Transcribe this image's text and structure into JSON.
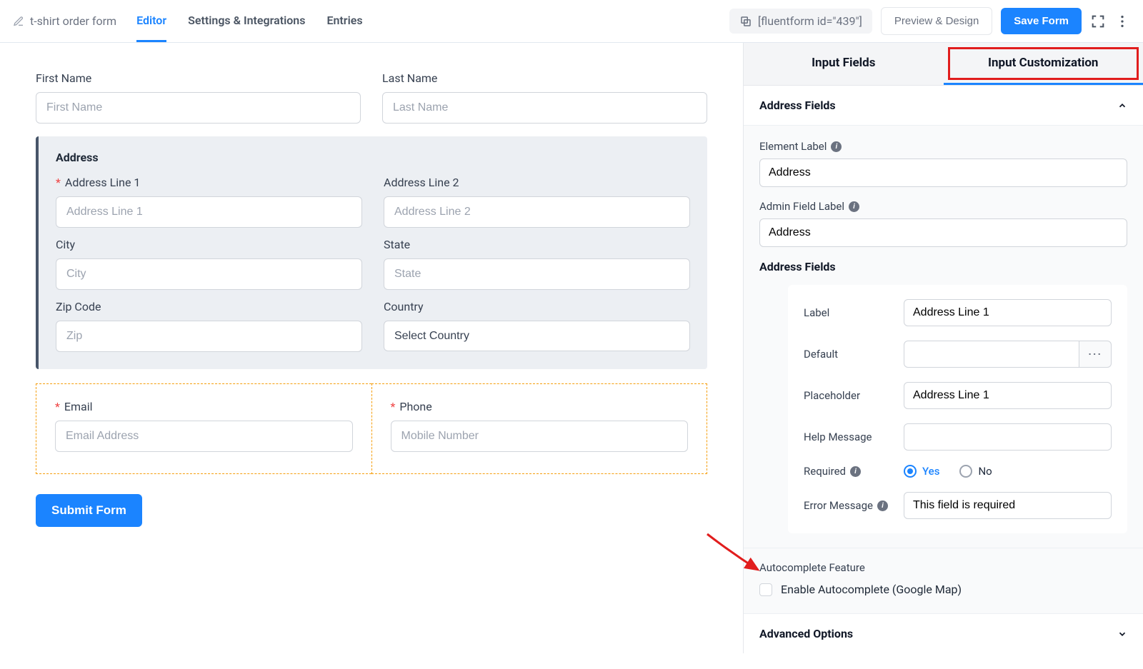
{
  "topbar": {
    "form_title": "t-shirt order form",
    "nav": {
      "editor": "Editor",
      "settings": "Settings & Integrations",
      "entries": "Entries"
    },
    "shortcode": "[fluentform id=\"439\"]",
    "preview_btn": "Preview & Design",
    "save_btn": "Save Form"
  },
  "canvas": {
    "first_name": {
      "label": "First Name",
      "placeholder": "First Name"
    },
    "last_name": {
      "label": "Last Name",
      "placeholder": "Last Name"
    },
    "address": {
      "title": "Address",
      "line1": {
        "label": "Address Line 1",
        "placeholder": "Address Line 1"
      },
      "line2": {
        "label": "Address Line 2",
        "placeholder": "Address Line 2"
      },
      "city": {
        "label": "City",
        "placeholder": "City"
      },
      "state": {
        "label": "State",
        "placeholder": "State"
      },
      "zip": {
        "label": "Zip Code",
        "placeholder": "Zip"
      },
      "country": {
        "label": "Country",
        "placeholder": "Select Country"
      }
    },
    "email": {
      "label": "Email",
      "placeholder": "Email Address"
    },
    "phone": {
      "label": "Phone",
      "placeholder": "Mobile Number"
    },
    "submit": "Submit Form"
  },
  "sidebar": {
    "tabs": {
      "fields": "Input Fields",
      "custom": "Input Customization"
    },
    "panel_title": "Address Fields",
    "element_label": {
      "label": "Element Label",
      "value": "Address"
    },
    "admin_label": {
      "label": "Admin Field Label",
      "value": "Address"
    },
    "subsection": "Address Fields",
    "card": {
      "label": {
        "name": "Label",
        "value": "Address Line 1"
      },
      "default": {
        "name": "Default",
        "value": ""
      },
      "placeholder": {
        "name": "Placeholder",
        "value": "Address Line 1"
      },
      "help": {
        "name": "Help Message",
        "value": ""
      },
      "required": {
        "name": "Required",
        "yes": "Yes",
        "no": "No"
      },
      "error": {
        "name": "Error Message",
        "value": "This field is required"
      }
    },
    "autocomplete": {
      "title": "Autocomplete Feature",
      "label": "Enable Autocomplete (Google Map)"
    },
    "advanced": "Advanced Options"
  }
}
